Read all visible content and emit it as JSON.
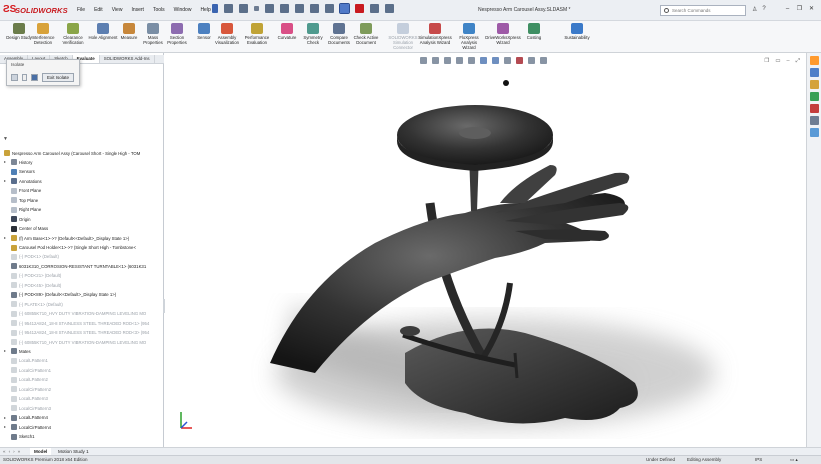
{
  "app": {
    "brand": "SOLIDWORKS",
    "doc_title": "Nespresso Arm Carousel Assy.SLDASM *"
  },
  "menu": [
    "File",
    "Edit",
    "View",
    "Insert",
    "Tools",
    "Window",
    "Help"
  ],
  "search": {
    "placeholder": "Search Commands"
  },
  "ribbon": [
    {
      "label": "Design Study",
      "color": "#6b7c4a",
      "dim": false
    },
    {
      "label": "Interference Detection",
      "color": "#d8a23a",
      "dim": false
    },
    {
      "label": "Clearance Verification",
      "color": "#8aa548",
      "dim": false
    },
    {
      "label": "Hole Alignment",
      "color": "#5d7fb1",
      "dim": false
    },
    {
      "label": "Measure",
      "color": "#c7873b",
      "dim": false
    },
    {
      "label": "Mass Properties",
      "color": "#7a8ea5",
      "dim": false
    },
    {
      "label": "Section Properties",
      "color": "#8d6cb0",
      "dim": false
    },
    {
      "label": "Sensor",
      "color": "#4c80c0",
      "dim": false
    },
    {
      "label": "Assembly Visualization",
      "color": "#d8573c",
      "dim": false
    },
    {
      "label": "Performance Evaluation",
      "color": "#c0a336",
      "dim": false
    },
    {
      "label": "Curvature",
      "color": "#d94f86",
      "dim": false
    },
    {
      "label": "Symmetry Check",
      "color": "#4f9a8e",
      "dim": false
    },
    {
      "label": "Compare Documents",
      "color": "#5f7392",
      "dim": false
    },
    {
      "label": "Check Active Document",
      "color": "#7e9b5a",
      "dim": false
    },
    {
      "label": "SOLIDWORKS Simulation Connector",
      "color": "#7b90b2",
      "dim": true
    },
    {
      "label": "SimulationXpress Analysis Wizard",
      "color": "#c74a4a",
      "dim": false
    },
    {
      "label": "FloXpress Analysis Wizard",
      "color": "#3f84c6",
      "dim": false
    },
    {
      "label": "DriveWorksXpress Wizard",
      "color": "#9e5aa7",
      "dim": false
    },
    {
      "label": "Costing",
      "color": "#3f8f63",
      "dim": false
    },
    {
      "label": "Sustainability",
      "color": "#3b7ac9",
      "dim": false
    }
  ],
  "tabs": [
    "Assembly",
    "Layout",
    "Sketch",
    "Evaluate",
    "SOLIDWORKS Add-Ins"
  ],
  "active_tab": "Evaluate",
  "isolate": {
    "title": "Isolate",
    "exit_label": "Exit Isolate"
  },
  "tree": [
    {
      "label": "Nespresso Arm Carousel Assy (Carousel Short - Single High - TOM",
      "depth": 0,
      "icon": "assembly-icon",
      "color": "#c9a23a",
      "grey": false,
      "exp": false
    },
    {
      "label": "History",
      "depth": 1,
      "icon": "history-icon",
      "color": "#7d8796",
      "grey": false,
      "exp": true
    },
    {
      "label": "Sensors",
      "depth": 1,
      "icon": "sensor-icon",
      "color": "#4f80b6",
      "grey": false,
      "exp": false
    },
    {
      "label": "Annotations",
      "depth": 1,
      "icon": "annotation-icon",
      "color": "#5a6e8d",
      "grey": false,
      "exp": true
    },
    {
      "label": "Front Plane",
      "depth": 1,
      "icon": "plane-icon",
      "color": "#b6bec9",
      "grey": false,
      "exp": false
    },
    {
      "label": "Top Plane",
      "depth": 1,
      "icon": "plane-icon",
      "color": "#b6bec9",
      "grey": false,
      "exp": false
    },
    {
      "label": "Right Plane",
      "depth": 1,
      "icon": "plane-icon",
      "color": "#b6bec9",
      "grey": false,
      "exp": false
    },
    {
      "label": "Origin",
      "depth": 1,
      "icon": "origin-icon",
      "color": "#3c4658",
      "grey": false,
      "exp": false
    },
    {
      "label": "Center of Mass",
      "depth": 1,
      "icon": "center-of-mass-icon",
      "color": "#2a2f38",
      "grey": false,
      "exp": false
    },
    {
      "label": "(f) Arm Base<1>->? (Default<<Default>_Display State 1>)",
      "depth": 1,
      "icon": "part-icon",
      "color": "#c9a23a",
      "grey": false,
      "exp": true
    },
    {
      "label": "Carousel Pod Holder<1>->? (Single Short High - Tombstone<",
      "depth": 1,
      "icon": "part-icon",
      "color": "#c9a23a",
      "grey": false,
      "exp": false
    },
    {
      "label": "(-) POD<1> (Default)",
      "depth": 1,
      "icon": "part-icon",
      "color": "#9aa3ad",
      "grey": true,
      "exp": false
    },
    {
      "label": "6031K310_CORROSION-RESISTANT TURNTABLE<1> (6031K31",
      "depth": 1,
      "icon": "part-icon",
      "color": "#6f7b8b",
      "grey": false,
      "exp": false
    },
    {
      "label": "(-) POD<21> (Default)",
      "depth": 1,
      "icon": "part-icon",
      "color": "#9aa3ad",
      "grey": true,
      "exp": false
    },
    {
      "label": "(-) POD<45> (Default)",
      "depth": 1,
      "icon": "part-icon",
      "color": "#9aa3ad",
      "grey": true,
      "exp": false
    },
    {
      "label": "(-) POD<89> (Default<<Default>_Display State 1>)",
      "depth": 1,
      "icon": "part-icon",
      "color": "#6f7b8b",
      "grey": false,
      "exp": false
    },
    {
      "label": "(-) PLATE<1> (Default)",
      "depth": 1,
      "icon": "part-icon",
      "color": "#9aa3ad",
      "grey": true,
      "exp": false
    },
    {
      "label": "(-) 60855K710_HVY DUTY VIBRATION-DAMPING LEVELING MO",
      "depth": 1,
      "icon": "part-icon",
      "color": "#9aa3ad",
      "grey": true,
      "exp": false
    },
    {
      "label": "(-) 95412A824_18-8 STAINLESS STEEL THREADED ROD<1> (954",
      "depth": 1,
      "icon": "part-icon",
      "color": "#9aa3ad",
      "grey": true,
      "exp": false
    },
    {
      "label": "(-) 95412A824_18-8 STAINLESS STEEL THREADED ROD<3> (954",
      "depth": 1,
      "icon": "part-icon",
      "color": "#9aa3ad",
      "grey": true,
      "exp": false
    },
    {
      "label": "(-) 60855K710_HVY DUTY VIBRATION-DAMPING LEVELING MO",
      "depth": 1,
      "icon": "part-icon",
      "color": "#9aa3ad",
      "grey": true,
      "exp": false
    },
    {
      "label": "Mates",
      "depth": 1,
      "icon": "mates-icon",
      "color": "#6f7b8b",
      "grey": false,
      "exp": true
    },
    {
      "label": "LocalLPattern1",
      "depth": 1,
      "icon": "pattern-icon",
      "color": "#9aa3ad",
      "grey": true,
      "exp": false
    },
    {
      "label": "LocalCirPattern1",
      "depth": 1,
      "icon": "pattern-icon",
      "color": "#9aa3ad",
      "grey": true,
      "exp": false
    },
    {
      "label": "LocalLPattern2",
      "depth": 1,
      "icon": "pattern-icon",
      "color": "#9aa3ad",
      "grey": true,
      "exp": false
    },
    {
      "label": "LocalCirPattern2",
      "depth": 1,
      "icon": "pattern-icon",
      "color": "#9aa3ad",
      "grey": true,
      "exp": false
    },
    {
      "label": "LocalLPattern3",
      "depth": 1,
      "icon": "pattern-icon",
      "color": "#9aa3ad",
      "grey": true,
      "exp": false
    },
    {
      "label": "LocalCirPattern3",
      "depth": 1,
      "icon": "pattern-icon",
      "color": "#9aa3ad",
      "grey": true,
      "exp": false
    },
    {
      "label": "LocalLPattern4",
      "depth": 1,
      "icon": "pattern-icon",
      "color": "#6f7b8b",
      "grey": false,
      "exp": true
    },
    {
      "label": "LocalCirPattern4",
      "depth": 1,
      "icon": "pattern-icon",
      "color": "#6f7b8b",
      "grey": false,
      "exp": true
    },
    {
      "label": "Sketch1",
      "depth": 1,
      "icon": "sketch-icon",
      "color": "#6f7b8b",
      "grey": false,
      "exp": false
    }
  ],
  "bottom_tabs": [
    "Model",
    "Motion Study 1"
  ],
  "active_bottom_tab": "Model",
  "status": {
    "edition": "SOLIDWORKS Premium 2018 x64 Edition",
    "state1": "Under Defined",
    "state2": "Editing Assembly",
    "units": "IPS"
  }
}
